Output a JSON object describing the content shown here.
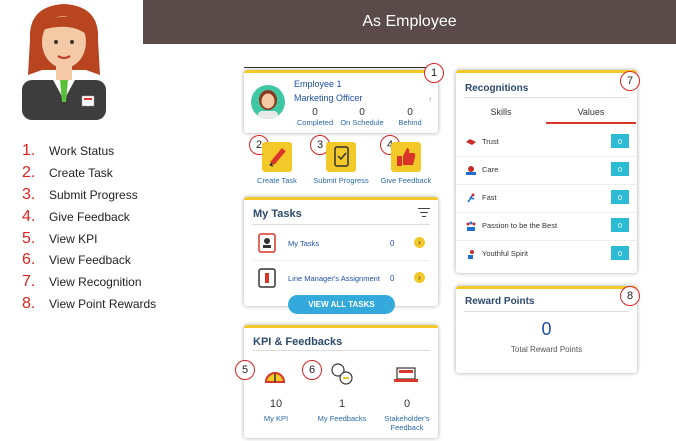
{
  "banner": {
    "title": "As Employee"
  },
  "legend": [
    {
      "num": "1.",
      "label": "Work Status"
    },
    {
      "num": "2.",
      "label": "Create Task"
    },
    {
      "num": "3.",
      "label": "Submit Progress"
    },
    {
      "num": "4.",
      "label": "Give Feedback"
    },
    {
      "num": "5.",
      "label": "View KPI"
    },
    {
      "num": "6.",
      "label": "View Feedback"
    },
    {
      "num": "7.",
      "label": "View Recognition"
    },
    {
      "num": "8.",
      "label": "View Point Rewards"
    }
  ],
  "employee": {
    "name": "Employee 1",
    "role": "Marketing Officer",
    "stats": [
      {
        "value": "0",
        "label": "Completed"
      },
      {
        "value": "0",
        "label": "On Schedule"
      },
      {
        "value": "0",
        "label": "Behind"
      }
    ]
  },
  "actions": [
    {
      "badge": "2",
      "label": "Create Task",
      "icon": "pencil-icon"
    },
    {
      "badge": "3",
      "label": "Submit Progress",
      "icon": "tablet-icon"
    },
    {
      "badge": "4",
      "label": "Give Feedback",
      "icon": "thumbs-up-icon"
    }
  ],
  "badges": {
    "b1": "1",
    "b5": "5",
    "b6": "6",
    "b7": "7",
    "b8": "8"
  },
  "tasks": {
    "title": "My Tasks",
    "rows": [
      {
        "label": "My Tasks",
        "count": "0"
      },
      {
        "label": "Line Manager's Assignment",
        "count": "0"
      }
    ],
    "button": "VIEW ALL TASKS"
  },
  "kpi": {
    "title": "KPI & Feedbacks",
    "items": [
      {
        "value": "10",
        "label": "My KPI"
      },
      {
        "value": "1",
        "label": "My Feedbacks"
      },
      {
        "value": "0",
        "label": "Stakeholder's Feedback"
      }
    ]
  },
  "recognitions": {
    "title": "Recognitions",
    "tabs": [
      "Skills",
      "Values"
    ],
    "active_tab": "Values",
    "rows": [
      {
        "label": "Trust",
        "count": "0",
        "color": "#c92b2b"
      },
      {
        "label": "Care",
        "count": "0",
        "color": "#1e6fd0"
      },
      {
        "label": "Fast",
        "count": "0",
        "color": "#c92b2b"
      },
      {
        "label": "Passion to be the Best",
        "count": "0",
        "color": "#1e6fd0"
      },
      {
        "label": "Youthful Spirit",
        "count": "0",
        "color": "#c92b2b"
      }
    ]
  },
  "reward": {
    "title": "Reward Points",
    "value": "0",
    "label": "Total Reward Points"
  },
  "colors": {
    "accent_yellow": "#f3c829",
    "banner": "#5a4a4a",
    "button_blue": "#33a9dc",
    "count_teal": "#2bbcd4"
  }
}
